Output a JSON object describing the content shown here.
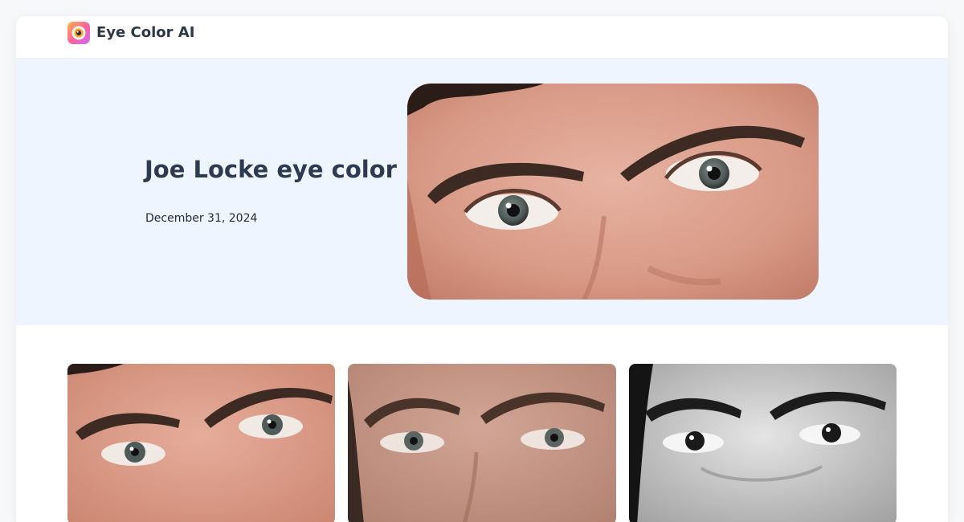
{
  "app": {
    "brand_name": "Eye Color AI",
    "logo_icon": "eye-logo-icon",
    "colors": {
      "hero_background": "#eef5ff",
      "title_text": "#2d3a4f",
      "logo_gradient": [
        "#ffb347",
        "#ff5fa2",
        "#c86bff"
      ]
    }
  },
  "hero": {
    "title": "Joe Locke eye color",
    "date": "December 31, 2024",
    "image": "eyes-closeup-photo"
  },
  "gallery": {
    "images": [
      {
        "name": "eyes-photo-color"
      },
      {
        "name": "eyes-photo-warm"
      },
      {
        "name": "eyes-photo-grayscale"
      }
    ]
  }
}
